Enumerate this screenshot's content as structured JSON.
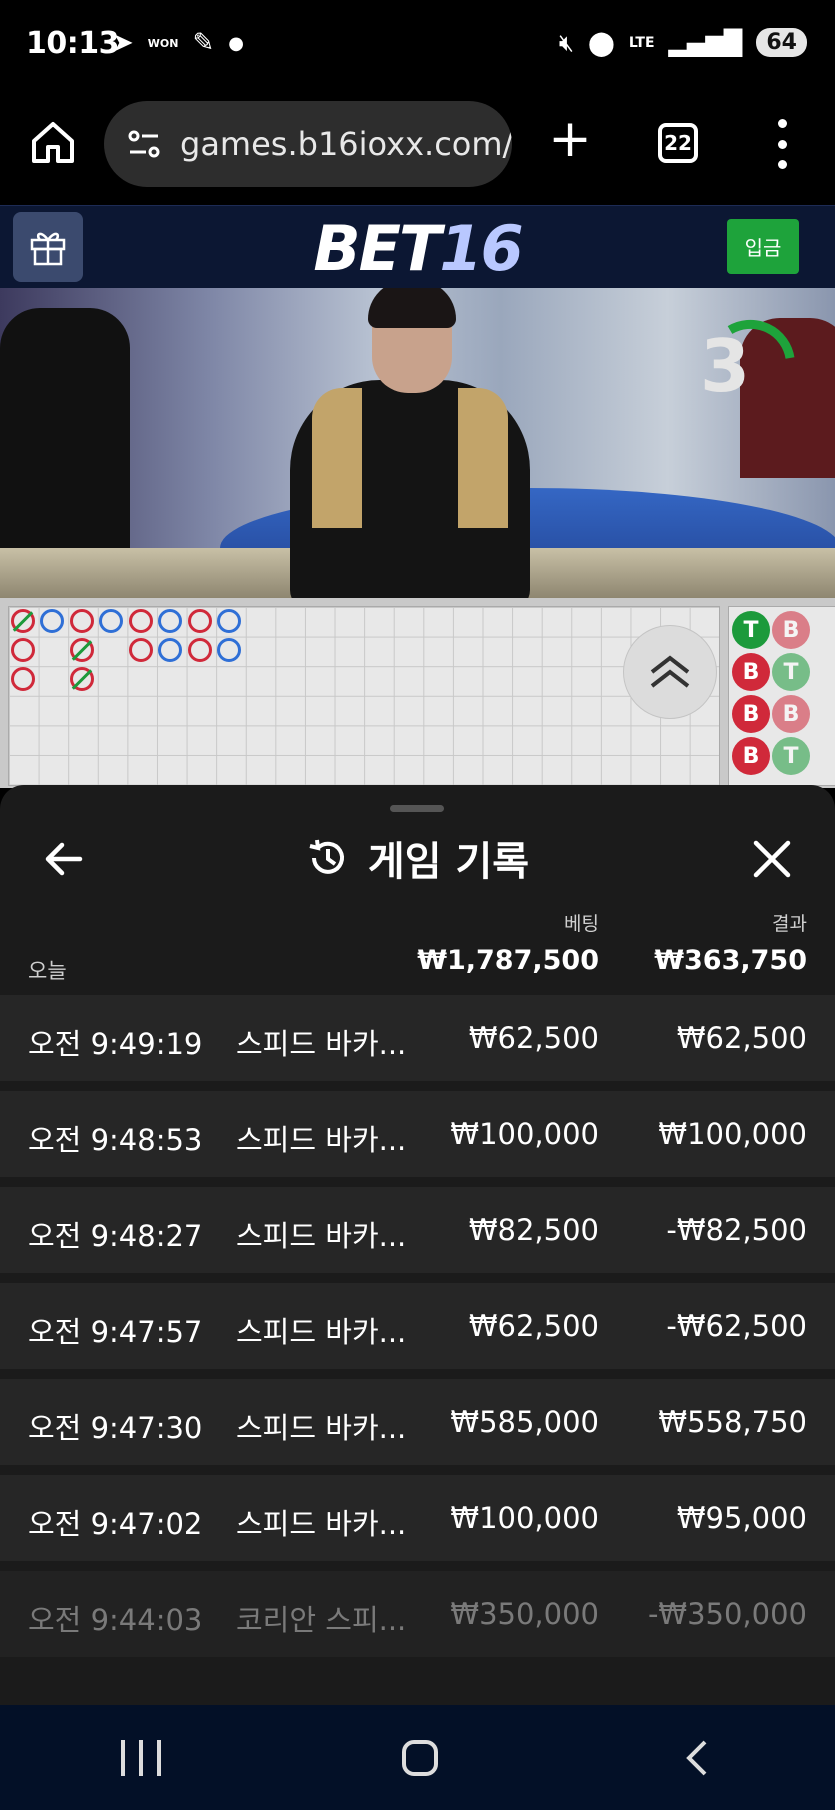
{
  "status_bar": {
    "time": "10:13",
    "won_label": "WON",
    "network": "LTE",
    "battery": "64"
  },
  "browser": {
    "url": "games.b16ioxx.com/",
    "tab_count": "22"
  },
  "site": {
    "logo_bet": "BET",
    "logo_num": "16",
    "deposit_label": "입금"
  },
  "video": {
    "countdown": "3"
  },
  "side_beads": [
    "T",
    "B",
    "B",
    "T",
    "B",
    "B",
    "B",
    "T"
  ],
  "history": {
    "title": "게임 기록",
    "col_bet": "베팅",
    "col_result": "결과",
    "today_label": "오늘",
    "total_bet": "₩1,787,500",
    "total_result": "₩363,750",
    "rows": [
      {
        "time": "오전 9:49:19",
        "game": "스피드 바카...",
        "bet": "₩62,500",
        "result": "₩62,500"
      },
      {
        "time": "오전 9:48:53",
        "game": "스피드 바카...",
        "bet": "₩100,000",
        "result": "₩100,000"
      },
      {
        "time": "오전 9:48:27",
        "game": "스피드 바카...",
        "bet": "₩82,500",
        "result": "-₩82,500"
      },
      {
        "time": "오전 9:47:57",
        "game": "스피드 바카...",
        "bet": "₩62,500",
        "result": "-₩62,500"
      },
      {
        "time": "오전 9:47:30",
        "game": "스피드 바카...",
        "bet": "₩585,000",
        "result": "₩558,750"
      },
      {
        "time": "오전 9:47:02",
        "game": "스피드 바카...",
        "bet": "₩100,000",
        "result": "₩95,000"
      },
      {
        "time": "오전 9:44:03",
        "game": "코리안 스피...",
        "bet": "₩350,000",
        "result": "-₩350,000"
      }
    ]
  },
  "colors": {
    "header_bg": "#0c1733",
    "deposit_green": "#1ea33b",
    "sheet_bg": "#1b1b1b",
    "banker_red": "#d0293a",
    "player_blue": "#2f6fd6",
    "tie_green": "#1c9a3b"
  }
}
